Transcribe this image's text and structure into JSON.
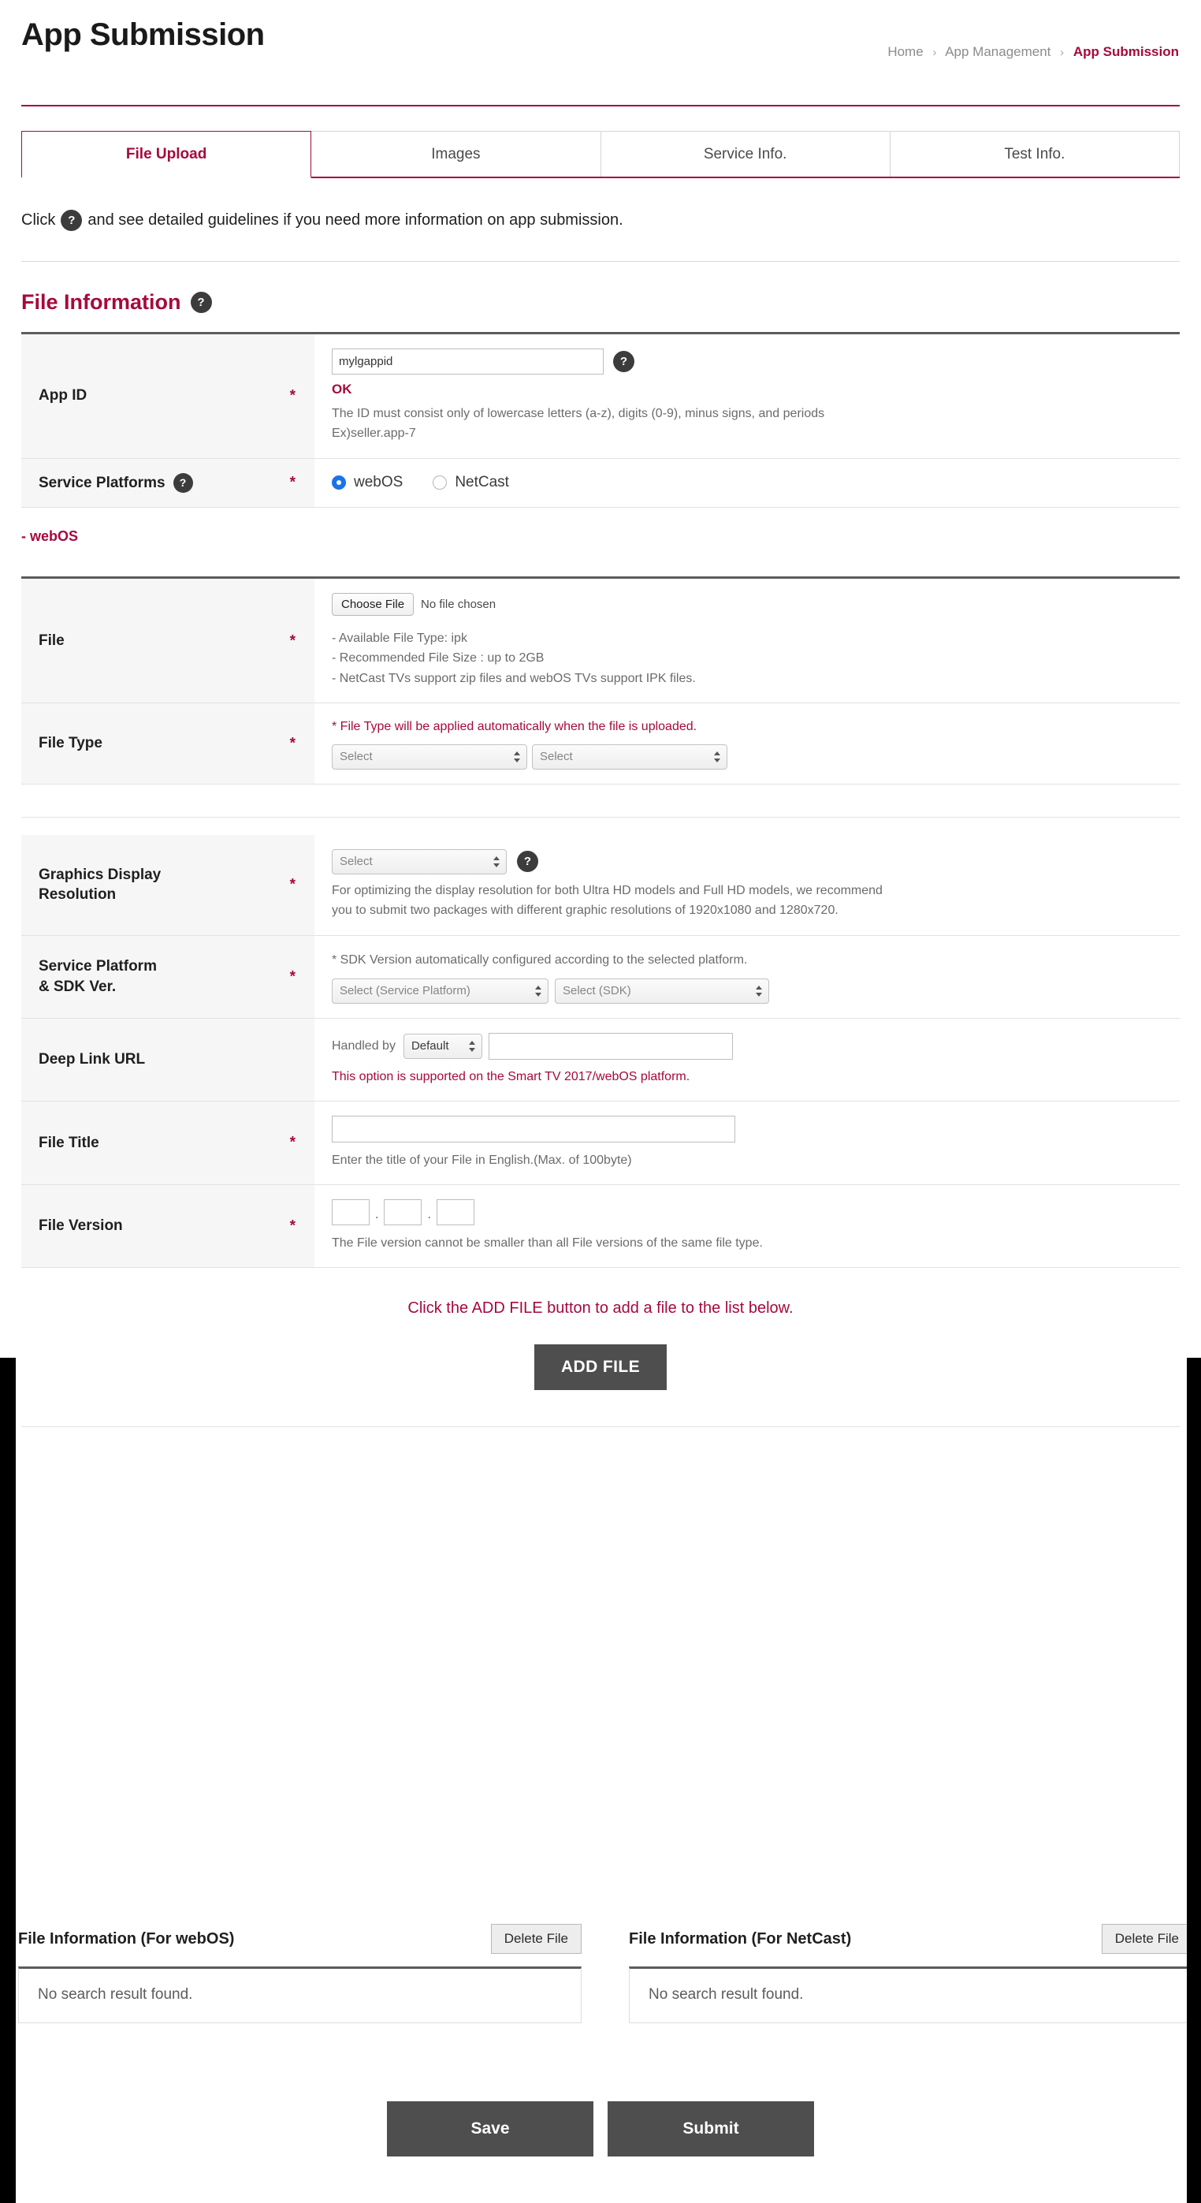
{
  "header": {
    "title": "App Submission",
    "breadcrumb": {
      "home": "Home",
      "section": "App Management",
      "current": "App Submission",
      "separator": "›"
    }
  },
  "tabs": [
    {
      "label": "File Upload",
      "active": true
    },
    {
      "label": "Images",
      "active": false
    },
    {
      "label": "Service Info.",
      "active": false
    },
    {
      "label": "Test Info.",
      "active": false
    }
  ],
  "intro": {
    "before": "Click",
    "after": "and see detailed guidelines if you need more information on app submission.",
    "help_glyph": "?"
  },
  "section": {
    "title": "File Information",
    "help_glyph": "?"
  },
  "fields": {
    "app_id": {
      "label": "App ID",
      "required": "*",
      "value": "mylgappid",
      "status": "OK",
      "hint_line1": "The ID must consist only of lowercase letters (a-z), digits (0-9), minus signs, and periods",
      "hint_line2": "Ex)seller.app-7"
    },
    "service_platforms": {
      "label": "Service Platforms",
      "required": "*",
      "options": [
        {
          "label": "webOS",
          "selected": true
        },
        {
          "label": "NetCast",
          "selected": false
        }
      ]
    },
    "webos_group": {
      "label": "- webOS"
    },
    "file": {
      "label": "File",
      "required": "*",
      "choose_label": "Choose File",
      "no_file_text": "No file chosen",
      "hint1": "- Available File Type: ipk",
      "hint2": "- Recommended File Size : up to 2GB",
      "hint3": "- NetCast TVs support zip files and webOS TVs support IPK files."
    },
    "file_type": {
      "label": "File Type",
      "required": "*",
      "note": "* File Type will be applied automatically when the file is uploaded.",
      "select1": "Select",
      "select2": "Select"
    },
    "graphics_resolution": {
      "label_line1": "Graphics Display",
      "label_line2": "Resolution",
      "required": "*",
      "select": "Select",
      "hint_line1": "For optimizing the display resolution for both Ultra HD models and Full HD models, we recommend",
      "hint_line2": "you to submit two packages with different graphic resolutions of 1920x1080 and 1280x720."
    },
    "service_platform_sdk": {
      "label_line1": "Service Platform",
      "label_line2": "& SDK Ver.",
      "required": "*",
      "note": "* SDK Version automatically configured according to the selected platform.",
      "select_platform": "Select (Service Platform)",
      "select_sdk": "Select (SDK)"
    },
    "deep_link_url": {
      "label": "Deep Link URL",
      "handled_by_label": "Handled by",
      "handled_by_value": "Default",
      "url_value": "",
      "note": "This option is supported on the Smart TV 2017/webOS platform."
    },
    "file_title": {
      "label": "File Title",
      "required": "*",
      "value": "",
      "hint": "Enter the title of your File in English.(Max. of 100byte)"
    },
    "file_version": {
      "label": "File Version",
      "required": "*",
      "part1": "",
      "part2": "",
      "part3": "",
      "separator": ".",
      "hint": "The File version cannot be smaller than all File versions of the same file type."
    }
  },
  "add_file_panel": {
    "message": "Click the ADD FILE button to add a file to the list below.",
    "button_label": "ADD FILE"
  },
  "result_lists": [
    {
      "title": "File Information (For webOS)",
      "delete_label": "Delete File",
      "empty_text": "No search result found."
    },
    {
      "title": "File Information (For NetCast)",
      "delete_label": "Delete File",
      "empty_text": "No search result found."
    }
  ],
  "footer": {
    "save_label": "Save",
    "submit_label": "Submit"
  },
  "colors": {
    "accent": "#A6093D",
    "dark_button": "#4e4e4e",
    "radio_selected": "#1a73e8"
  }
}
